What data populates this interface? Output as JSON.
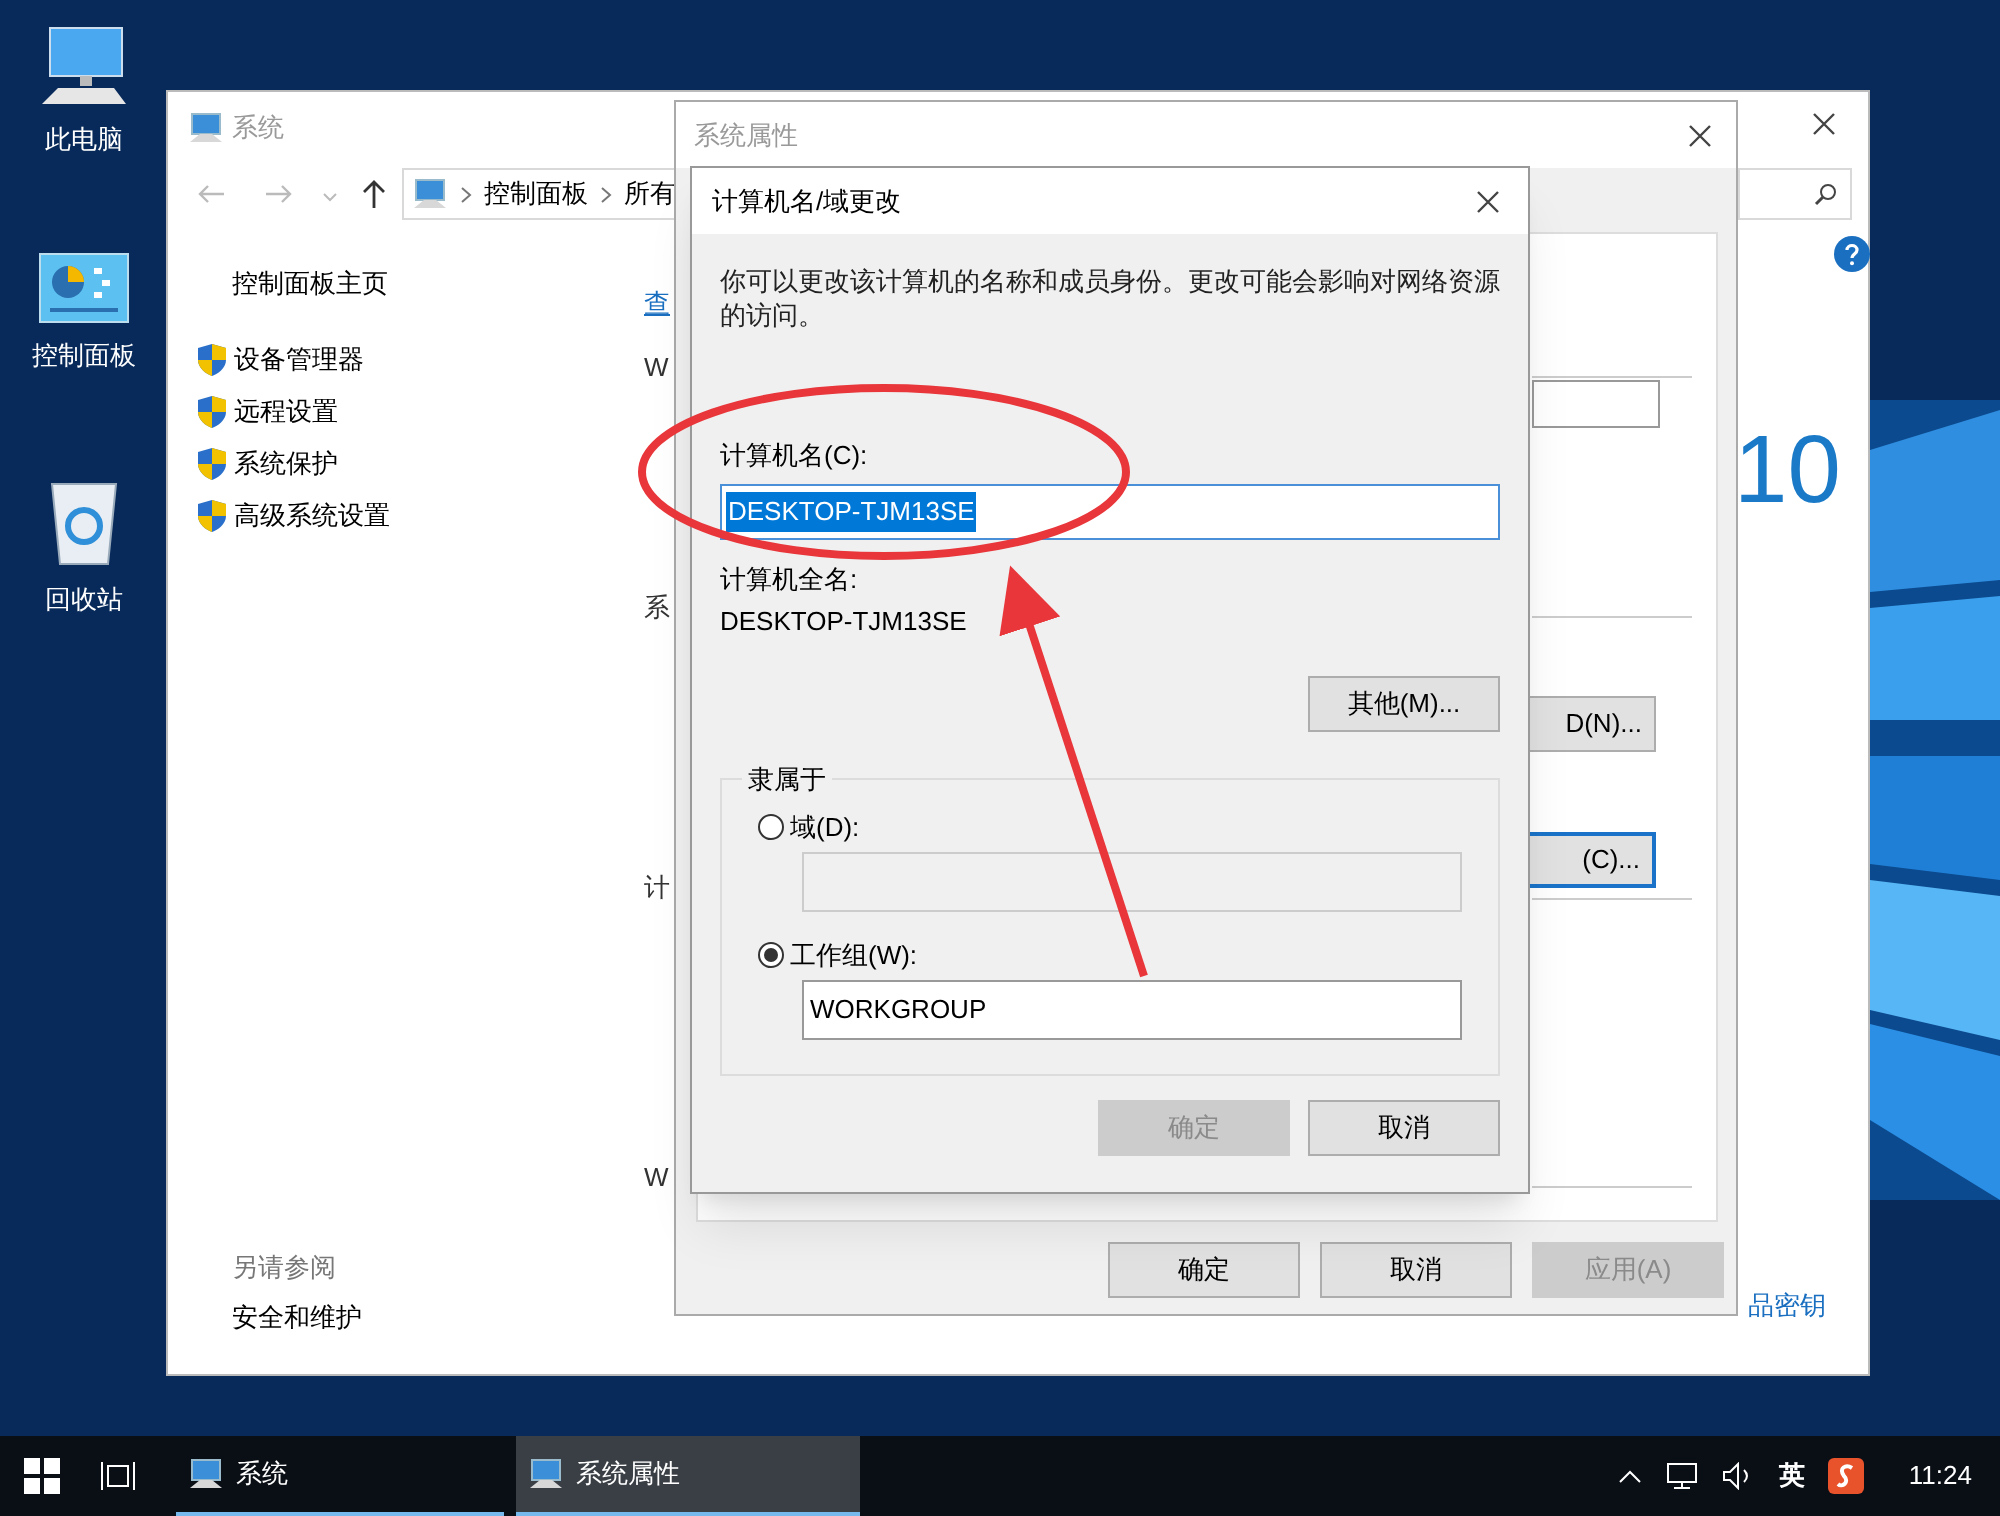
{
  "desktop_icons": [
    {
      "label": "此电脑",
      "kind": "computer"
    },
    {
      "label": "控制面板",
      "kind": "control-panel"
    },
    {
      "label": "回收站",
      "kind": "recycle-bin"
    }
  ],
  "system_window": {
    "title": "系统",
    "breadcrumb": [
      "控制面板",
      "所有"
    ],
    "sidebar_home": "控制面板主页",
    "sidebar_items": [
      "设备管理器",
      "远程设置",
      "系统保护",
      "高级系统设置"
    ],
    "content_fragments": [
      {
        "text": "查",
        "kind": "link"
      },
      {
        "text": "W",
        "kind": "text"
      },
      {
        "text": "系",
        "kind": "text"
      },
      {
        "text": "计",
        "kind": "text"
      },
      {
        "text": "W",
        "kind": "text"
      }
    ],
    "logo_text": "10",
    "see_also_heading": "另请参阅",
    "see_also_items": [
      "安全和维护"
    ],
    "product_key_link": "品密钥"
  },
  "system_properties": {
    "title": "系统属性",
    "hidden_buttons": [
      {
        "label": "D(N)...",
        "focused": false
      },
      {
        "label": "(C)...",
        "focused": true
      }
    ],
    "buttons": [
      {
        "label": "确定",
        "disabled": false
      },
      {
        "label": "取消",
        "disabled": false
      },
      {
        "label": "应用(A)",
        "disabled": true
      }
    ]
  },
  "dialog": {
    "title": "计算机名/域更改",
    "description": "你可以更改该计算机的名称和成员身份。更改可能会影响对网络资源的访问。",
    "computer_name_label": "计算机名(C):",
    "computer_name_value": "DESKTOP-TJM13SE",
    "computer_name_selected": true,
    "full_name_label": "计算机全名:",
    "full_name_value": "DESKTOP-TJM13SE",
    "more_button": "其他(M)...",
    "member_of_label": "隶属于",
    "member_options": [
      {
        "label": "域(D):",
        "selected": false,
        "field_disabled": true
      },
      {
        "label": "工作组(W):",
        "selected": true,
        "field_disabled": false,
        "value": "WORKGROUP"
      }
    ],
    "buttons": [
      {
        "label": "确定",
        "disabled": true
      },
      {
        "label": "取消",
        "disabled": false
      }
    ]
  },
  "taskbar": {
    "items": [
      {
        "label": "系统",
        "selected": false
      },
      {
        "label": "系统属性",
        "selected": true
      }
    ],
    "ime": "英",
    "time": "11:24"
  }
}
